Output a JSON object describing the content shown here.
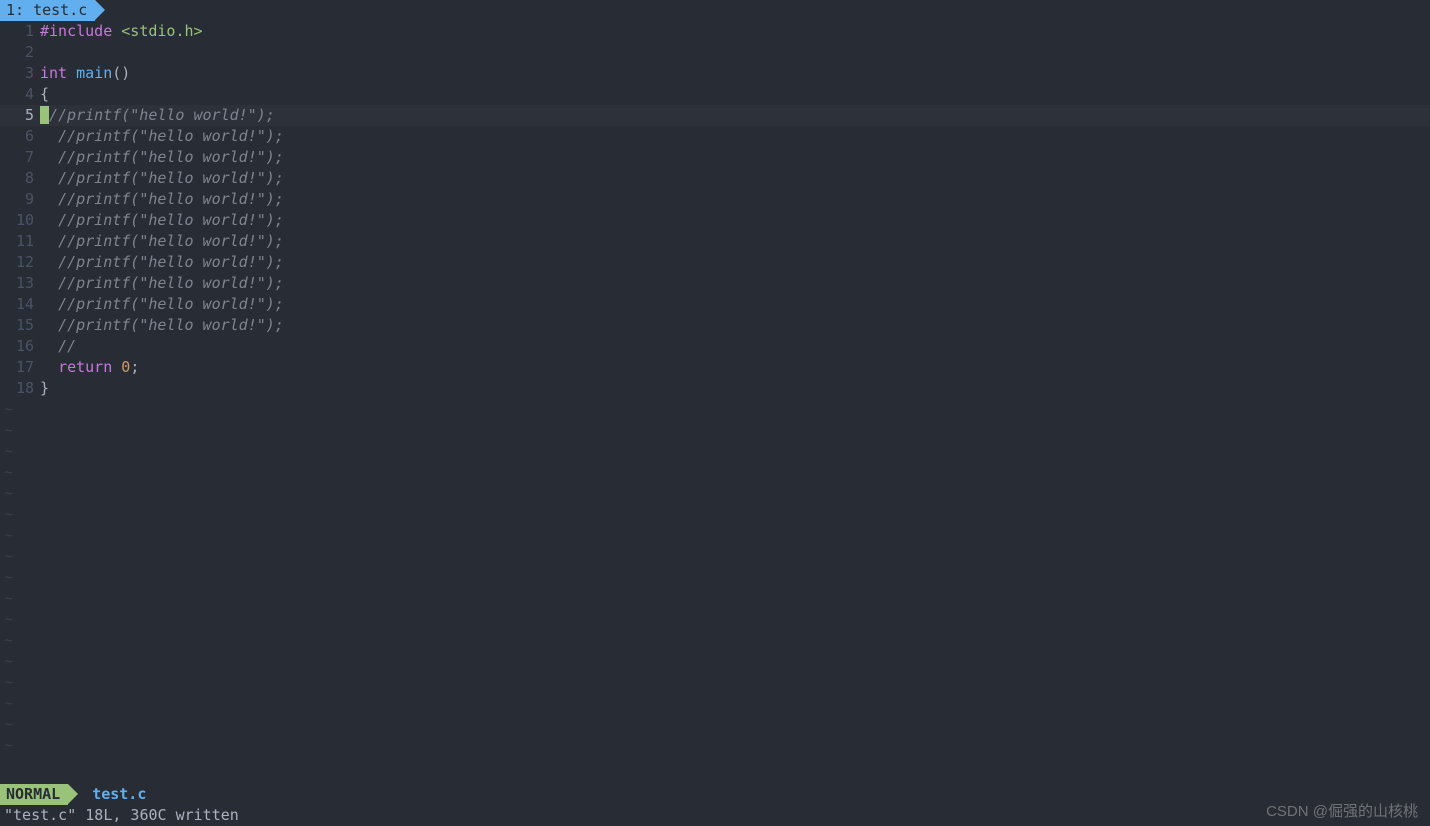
{
  "tab": {
    "index": "1",
    "name": "test.c"
  },
  "cursor_line": 5,
  "total_lines": 18,
  "empty_rows": 17,
  "lines": [
    {
      "n": 1,
      "tokens": [
        {
          "cls": "c-pre",
          "t": "#include"
        },
        {
          "cls": "c-pun",
          "t": " "
        },
        {
          "cls": "c-inc",
          "t": "<stdio.h>"
        }
      ]
    },
    {
      "n": 2,
      "tokens": []
    },
    {
      "n": 3,
      "tokens": [
        {
          "cls": "c-kw",
          "t": "int"
        },
        {
          "cls": "c-pun",
          "t": " "
        },
        {
          "cls": "c-fn",
          "t": "main"
        },
        {
          "cls": "c-pun",
          "t": "()"
        }
      ]
    },
    {
      "n": 4,
      "tokens": [
        {
          "cls": "c-pun",
          "t": "{"
        }
      ]
    },
    {
      "n": 5,
      "cursor": true,
      "tokens": [
        {
          "cls": "c-cm",
          "t": "//printf(\"hello world!\");"
        }
      ]
    },
    {
      "n": 6,
      "tokens": [
        {
          "cls": "c-pun",
          "t": "  "
        },
        {
          "cls": "c-cm",
          "t": "//printf(\"hello world!\");"
        }
      ]
    },
    {
      "n": 7,
      "tokens": [
        {
          "cls": "c-pun",
          "t": "  "
        },
        {
          "cls": "c-cm",
          "t": "//printf(\"hello world!\");"
        }
      ]
    },
    {
      "n": 8,
      "tokens": [
        {
          "cls": "c-pun",
          "t": "  "
        },
        {
          "cls": "c-cm",
          "t": "//printf(\"hello world!\");"
        }
      ]
    },
    {
      "n": 9,
      "tokens": [
        {
          "cls": "c-pun",
          "t": "  "
        },
        {
          "cls": "c-cm",
          "t": "//printf(\"hello world!\");"
        }
      ]
    },
    {
      "n": 10,
      "tokens": [
        {
          "cls": "c-pun",
          "t": "  "
        },
        {
          "cls": "c-cm",
          "t": "//printf(\"hello world!\");"
        }
      ]
    },
    {
      "n": 11,
      "tokens": [
        {
          "cls": "c-pun",
          "t": "  "
        },
        {
          "cls": "c-cm",
          "t": "//printf(\"hello world!\");"
        }
      ]
    },
    {
      "n": 12,
      "tokens": [
        {
          "cls": "c-pun",
          "t": "  "
        },
        {
          "cls": "c-cm",
          "t": "//printf(\"hello world!\");"
        }
      ]
    },
    {
      "n": 13,
      "tokens": [
        {
          "cls": "c-pun",
          "t": "  "
        },
        {
          "cls": "c-cm",
          "t": "//printf(\"hello world!\");"
        }
      ]
    },
    {
      "n": 14,
      "tokens": [
        {
          "cls": "c-pun",
          "t": "  "
        },
        {
          "cls": "c-cm",
          "t": "//printf(\"hello world!\");"
        }
      ]
    },
    {
      "n": 15,
      "tokens": [
        {
          "cls": "c-pun",
          "t": "  "
        },
        {
          "cls": "c-cm",
          "t": "//printf(\"hello world!\");"
        }
      ]
    },
    {
      "n": 16,
      "tokens": [
        {
          "cls": "c-pun",
          "t": "  "
        },
        {
          "cls": "c-cm",
          "t": "//"
        }
      ]
    },
    {
      "n": 17,
      "tokens": [
        {
          "cls": "c-pun",
          "t": "  "
        },
        {
          "cls": "c-kw",
          "t": "return"
        },
        {
          "cls": "c-pun",
          "t": " "
        },
        {
          "cls": "c-num",
          "t": "0"
        },
        {
          "cls": "c-pun",
          "t": ";"
        }
      ]
    },
    {
      "n": 18,
      "tokens": [
        {
          "cls": "c-pun",
          "t": "}"
        }
      ]
    }
  ],
  "status": {
    "mode": "NORMAL",
    "file": "test.c"
  },
  "cmdline": "\"test.c\" 18L, 360C written",
  "watermark": "CSDN @倔强的山核桃",
  "tilde_char": "~"
}
